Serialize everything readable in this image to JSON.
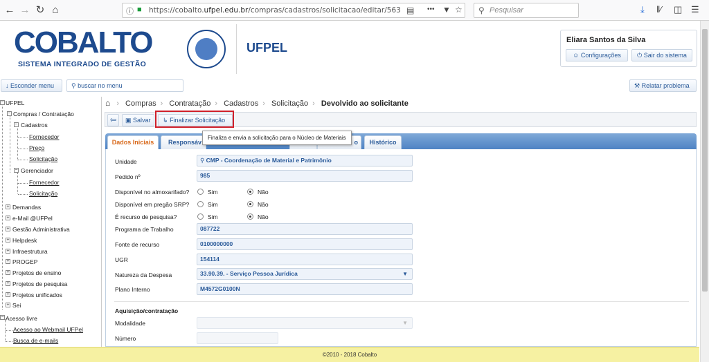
{
  "browser": {
    "url_prefix": "https://cobalto.",
    "url_domain": "ufpel.edu.br",
    "url_suffix": "/compras/cadastros/solicitacao/editar/563",
    "search_placeholder": "Pesquisar",
    "menu_dots": "•••"
  },
  "header": {
    "logo_text": "COBALTO",
    "logo_subtitle": "SISTEMA INTEGRADO DE GESTÃO",
    "institution": "UFPEL",
    "user_name": "Eliara Santos da Silva",
    "settings_label": "Configurações",
    "logout_label": "Sair do sistema"
  },
  "toolbar": {
    "hide_menu_label": "Esconder menu",
    "search_menu_placeholder": "buscar no menu",
    "report_problem_label": "Relatar problema"
  },
  "sidebar": {
    "root": "UFPEL",
    "compras": "Compras / Contratação",
    "cadastros": "Cadastros",
    "fornecedor": "Fornecedor",
    "preco": "Preço",
    "solicitacao": "Solicitação",
    "gerenciador": "Gerenciador",
    "g_fornecedor": "Fornecedor",
    "g_solicitacao": "Solicitação",
    "demandas": "Demandas",
    "email": "e-Mail @UFPel",
    "gestao": "Gestão Administrativa",
    "helpdesk": "Helpdesk",
    "infra": "Infraestrutura",
    "progep": "PROGEP",
    "ensino": "Projetos de ensino",
    "pesquisa": "Projetos de pesquisa",
    "unificados": "Projetos unificados",
    "sei": "Sei",
    "acesso_livre": "Acesso livre",
    "webmail": "Acesso ao Webmail UFPel",
    "busca_emails": "Busca de e-mails"
  },
  "breadcrumb": [
    "Compras",
    "Contratação",
    "Cadastros",
    "Solicitação"
  ],
  "breadcrumb_current": "Devolvido ao solicitante",
  "actions": {
    "save_label": "Salvar",
    "finalize_label": "Finalizar Solicitação",
    "tooltip": "Finaliza e envia a solicitação para o Núcleo de Materiais"
  },
  "tabs": [
    "Dados Iniciais",
    "Responsáv",
    "o",
    "Histórico"
  ],
  "form": {
    "unidade_label": "Unidade",
    "unidade_value": "CMP - Coordenação de Material e Patrimônio",
    "pedido_label": "Pedido nº",
    "pedido_value": "985",
    "almox_label": "Disponível no almoxarifado?",
    "pregao_label": "Disponível em pregão SRP?",
    "pesquisa_label": "É recurso de pesquisa?",
    "sim": "Sim",
    "nao": "Não",
    "programa_label": "Programa de Trabalho",
    "programa_value": "087722",
    "fonte_label": "Fonte de recurso",
    "fonte_value": "0100000000",
    "ugr_label": "UGR",
    "ugr_value": "154114",
    "natureza_label": "Natureza da Despesa",
    "natureza_value": "33.90.39. - Serviço Pessoa Jurídica",
    "plano_label": "Plano Interno",
    "plano_value": "M4572G0100N",
    "aquisicao_title": "Aquisição/contratação",
    "modalidade_label": "Modalidade",
    "numero_label": "Número"
  },
  "footer": "©2010 - 2018 Cobalto"
}
